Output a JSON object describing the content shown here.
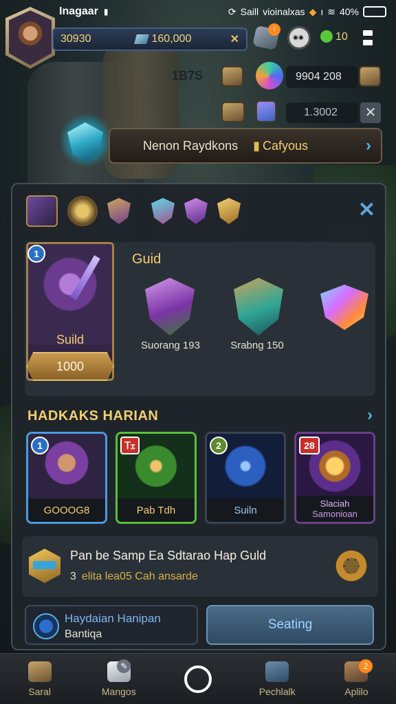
{
  "status_bar": {
    "carrier": "Inagaar",
    "center": "Ѕaill",
    "network": "vioinalxas",
    "battery": "40%",
    "battery_level": 0.8
  },
  "top_hud": {
    "gold": "30930",
    "gems": "160,000",
    "coins": "10"
  },
  "row2": {
    "faded_label": "1B7S",
    "resource_a": "9904 208",
    "resource_b": "1.3002"
  },
  "banner": {
    "left": "Nenon Raydkons",
    "right": "Cafyous"
  },
  "guild_panel": {
    "title": "Guid",
    "hero_card": {
      "level": "1",
      "name": "Suild",
      "price": "1000"
    },
    "emblems": [
      {
        "label": "Suorang 193"
      },
      {
        "label": "Srabng 150"
      },
      {
        "label": ""
      }
    ]
  },
  "daily": {
    "heading": "HADKAKS HARIAN",
    "cards": [
      {
        "badge": "1",
        "label": "GOOOG8",
        "label2": ""
      },
      {
        "badge": "Ꭲꮖ",
        "label": "Pab Tdh",
        "label2": ""
      },
      {
        "badge": "2",
        "label": "Suiln",
        "label2": ""
      },
      {
        "badge": "28",
        "label": "Slaciah",
        "label2": "Samonioan"
      }
    ]
  },
  "task": {
    "title": "Pan be Samp Ea Sdtarao Hap Guld",
    "count": "3",
    "detail": "elita lea05 Cah ansarde"
  },
  "bottom_actions": {
    "info_title": "Haydaian Hanipan",
    "info_sub": "Bantiqa",
    "primary_button": "Seating"
  },
  "nav": [
    {
      "label": "Saral",
      "badge": ""
    },
    {
      "label": "Mangos",
      "badge": ""
    },
    {
      "label": "",
      "badge": ""
    },
    {
      "label": "Pechlalk",
      "badge": ""
    },
    {
      "label": "Aplilo",
      "badge": "2"
    }
  ]
}
